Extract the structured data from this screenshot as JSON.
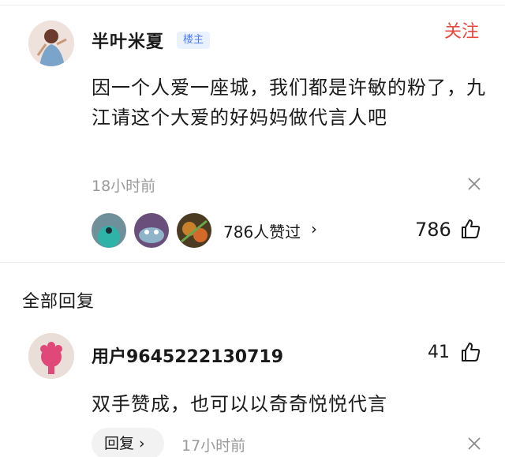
{
  "post": {
    "author": "半叶米夏",
    "badge": "楼主",
    "follow_label": "关注",
    "text": "因一个人爱一座城，我们都是许敏的粉了，九江请这个大爱的好妈妈做代言人吧",
    "time": "18小时前",
    "likes_text": "786人赞过",
    "likes_chevron": "›",
    "like_count": "786"
  },
  "replies_section": {
    "title": "全部回复"
  },
  "reply": {
    "user": "用户9645222130719",
    "like_count": "41",
    "text": "双手赞成，也可以以奇奇悦悦代言",
    "reply_label": "回复 ›",
    "time": "17小时前"
  },
  "icons": {
    "dismiss": "close-x-icon",
    "like": "thumbs-up-icon"
  },
  "colors": {
    "accent_red": "#e8493c",
    "badge_blue": "#4d7cf3",
    "muted_gray": "#9a9a9a"
  }
}
